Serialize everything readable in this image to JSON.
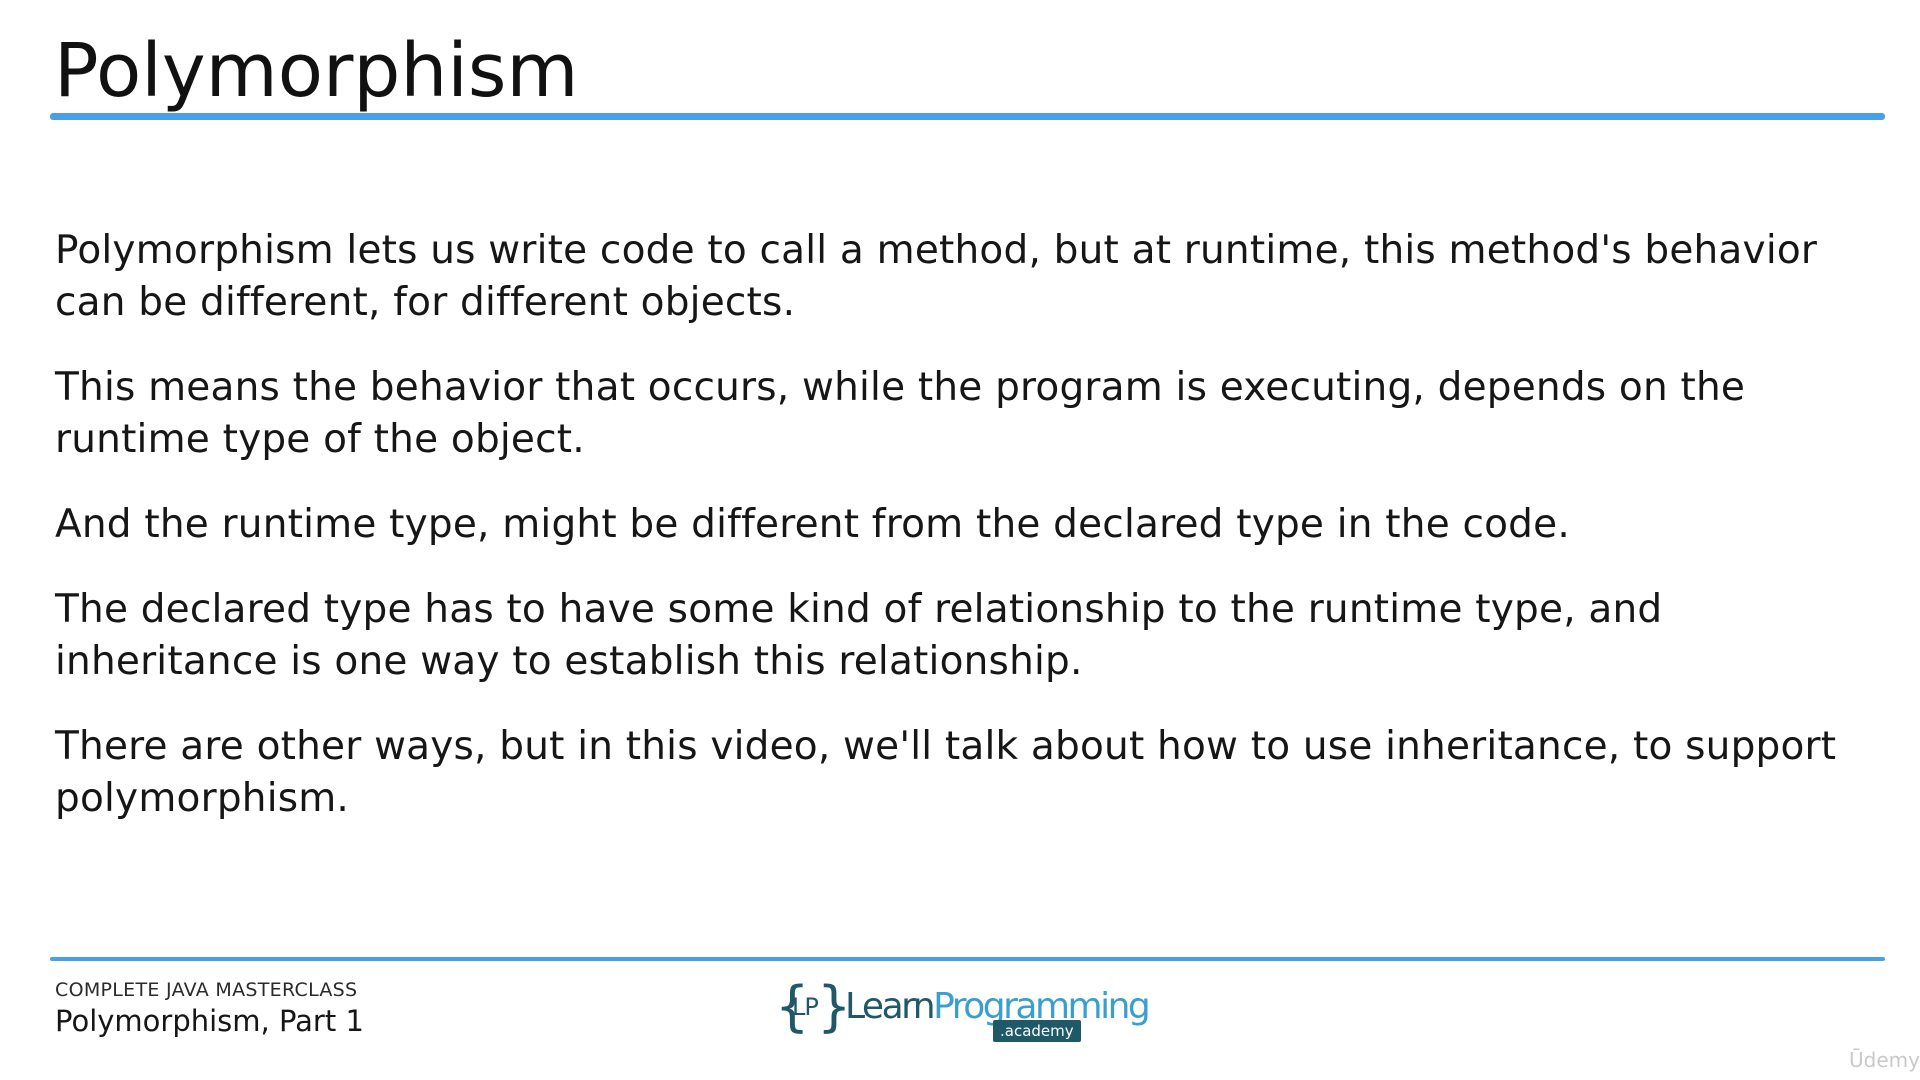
{
  "colors": {
    "accent_blue": "#4a9fe6",
    "logo_dark": "#1f5968",
    "logo_light": "#3a9fcf"
  },
  "slide": {
    "title": "Polymorphism",
    "paragraphs": [
      "Polymorphism lets us write code to call a method, but at runtime, this method's behavior can be different, for different objects.",
      "This means the behavior that occurs, while the program is executing, depends on the runtime type of the object.",
      "And the runtime type, might be different from the declared type in the code.",
      "The declared type has to have some kind of relationship to the runtime type, and inheritance is one way to establish this relationship.",
      "There are other ways, but in this video, we'll talk about how to use inheritance, to support polymorphism."
    ]
  },
  "footer": {
    "course": "COMPLETE JAVA MASTERCLASS",
    "lesson": "Polymorphism, Part 1"
  },
  "logo": {
    "brace_left": "{",
    "initials": "LP",
    "brace_right": "}",
    "name_learn": "Learn",
    "name_programming": "Programming",
    "badge": ".academy"
  },
  "watermark": "Ūdemy"
}
